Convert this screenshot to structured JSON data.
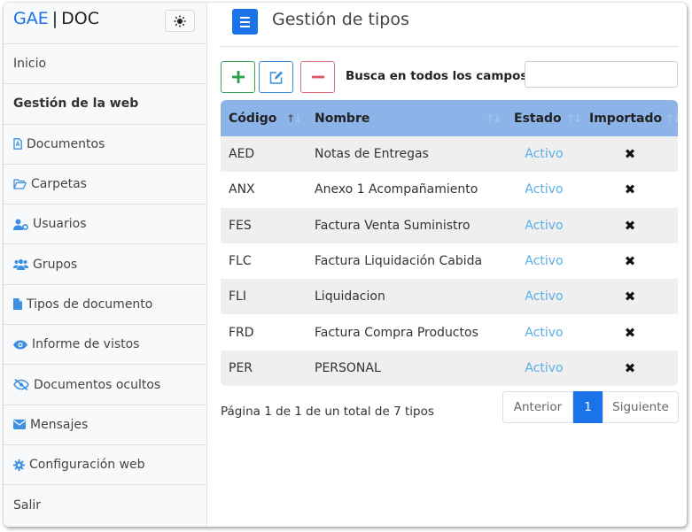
{
  "brand": {
    "part1": "GAE",
    "separator": "|",
    "part2": "DOC"
  },
  "sidebar": {
    "items": [
      {
        "label": "Inicio",
        "icon": "none"
      },
      {
        "label": "Gestión de la web",
        "icon": "none",
        "active": true
      },
      {
        "label": "Documentos",
        "icon": "pdf-file-icon"
      },
      {
        "label": "Carpetas",
        "icon": "folder-open-icon"
      },
      {
        "label": "Usuarios",
        "icon": "user-cog-icon"
      },
      {
        "label": "Grupos",
        "icon": "users-icon"
      },
      {
        "label": "Tipos de documento",
        "icon": "file-icon"
      },
      {
        "label": "Informe de vistos",
        "icon": "eye-icon"
      },
      {
        "label": "Documentos ocultos",
        "icon": "eye-slash-icon"
      },
      {
        "label": "Mensajes",
        "icon": "envelope-icon"
      },
      {
        "label": "Configuración web",
        "icon": "gear-icon"
      },
      {
        "label": "Salir",
        "icon": "none"
      }
    ]
  },
  "header": {
    "title": "Gestión de tipos"
  },
  "toolbar": {
    "search_label": "Busca en todos los campos:",
    "search_value": ""
  },
  "table": {
    "columns": [
      "Código",
      "Nombre",
      "Estado",
      "Importado"
    ],
    "rows": [
      {
        "codigo": "AED",
        "nombre": "Notas de Entregas",
        "estado": "Activo",
        "importado": "✖"
      },
      {
        "codigo": "ANX",
        "nombre": "Anexo 1 Acompañamiento",
        "estado": "Activo",
        "importado": "✖"
      },
      {
        "codigo": "FES",
        "nombre": "Factura Venta Suministro",
        "estado": "Activo",
        "importado": "✖"
      },
      {
        "codigo": "FLC",
        "nombre": "Factura Liquidación Cabida",
        "estado": "Activo",
        "importado": "✖"
      },
      {
        "codigo": "FLI",
        "nombre": "Liquidacion",
        "estado": "Activo",
        "importado": "✖"
      },
      {
        "codigo": "FRD",
        "nombre": "Factura Compra Productos",
        "estado": "Activo",
        "importado": "✖"
      },
      {
        "codigo": "PER",
        "nombre": "PERSONAL",
        "estado": "Activo",
        "importado": "✖"
      }
    ]
  },
  "footer": {
    "info": "Página 1 de 1 de un total de 7 tipos"
  },
  "pagination": {
    "prev": "Anterior",
    "current": "1",
    "next": "Siguiente"
  },
  "colors": {
    "accent": "#1a73e8",
    "header_bg": "#8db4e8",
    "status_active": "#5aaee8",
    "add": "#3aa655",
    "edit": "#3d8fe0",
    "delete": "#e36c7a"
  }
}
